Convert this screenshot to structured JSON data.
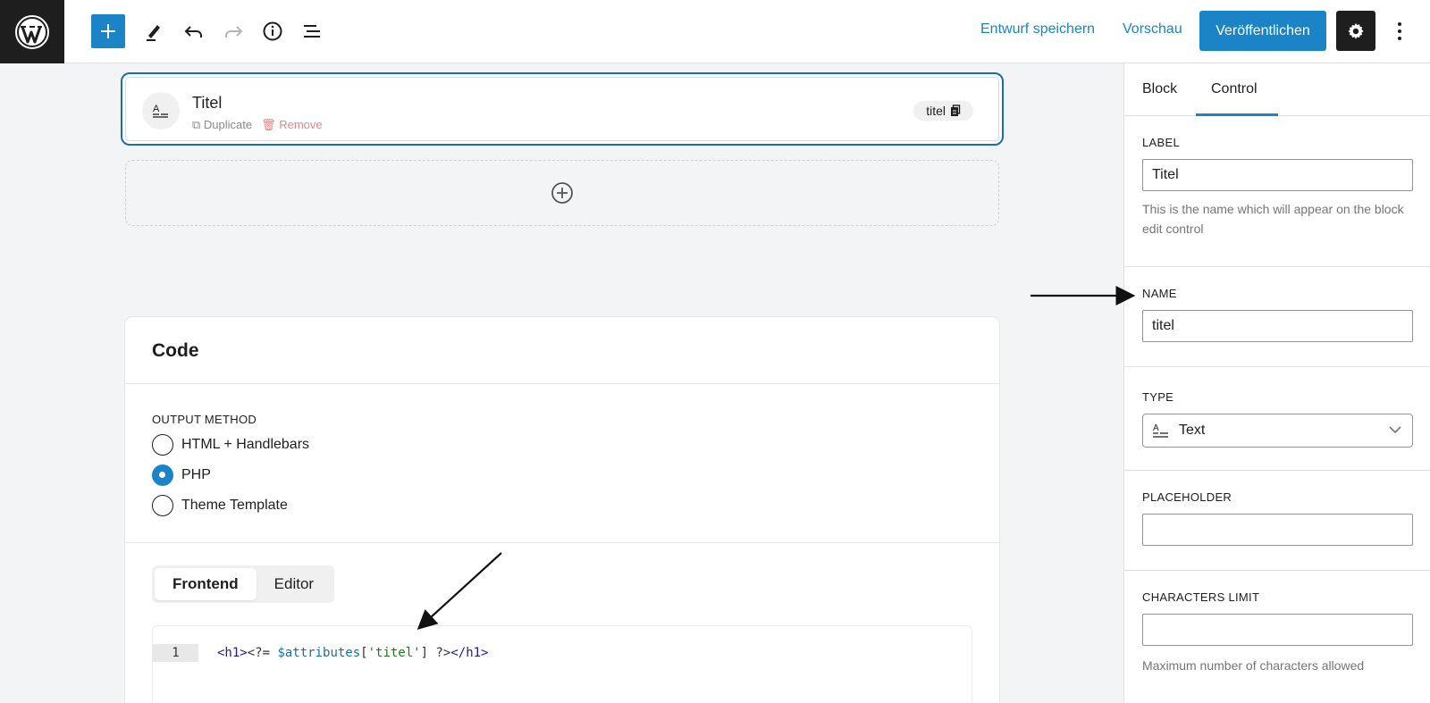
{
  "toolbar": {
    "save_draft": "Entwurf speichern",
    "preview": "Vorschau",
    "publish": "Veröffentlichen"
  },
  "field": {
    "title": "Titel",
    "duplicate": "Duplicate",
    "remove": "Remove",
    "slug": "titel"
  },
  "code": {
    "heading": "Code",
    "output_method_label": "OUTPUT METHOD",
    "options": [
      "HTML + Handlebars",
      "PHP",
      "Theme Template"
    ],
    "selected": "PHP",
    "tabs": [
      "Frontend",
      "Editor"
    ],
    "active_tab": "Frontend",
    "line_number": "1",
    "line": {
      "open_tag": "<h1>",
      "php_open": "<?= ",
      "var": "$attributes",
      "bracket_open": "[",
      "key": "'titel'",
      "bracket_close": "]",
      "php_close": " ?>",
      "close_tag": "</h1>"
    }
  },
  "sidebar": {
    "tabs": [
      "Block",
      "Control"
    ],
    "active_tab": "Control",
    "label": {
      "heading": "LABEL",
      "value": "Titel",
      "help": "This is the name which will appear on the block edit control"
    },
    "name": {
      "heading": "NAME",
      "value": "titel"
    },
    "type": {
      "heading": "TYPE",
      "value": "Text"
    },
    "placeholder": {
      "heading": "PLACEHOLDER",
      "value": ""
    },
    "characters_limit": {
      "heading": "CHARACTERS LIMIT",
      "value": "",
      "help": "Maximum number of characters allowed"
    }
  },
  "colors": {
    "accent": "#1a84c7",
    "dark": "#1e1e1e",
    "remove": "#e58585"
  }
}
